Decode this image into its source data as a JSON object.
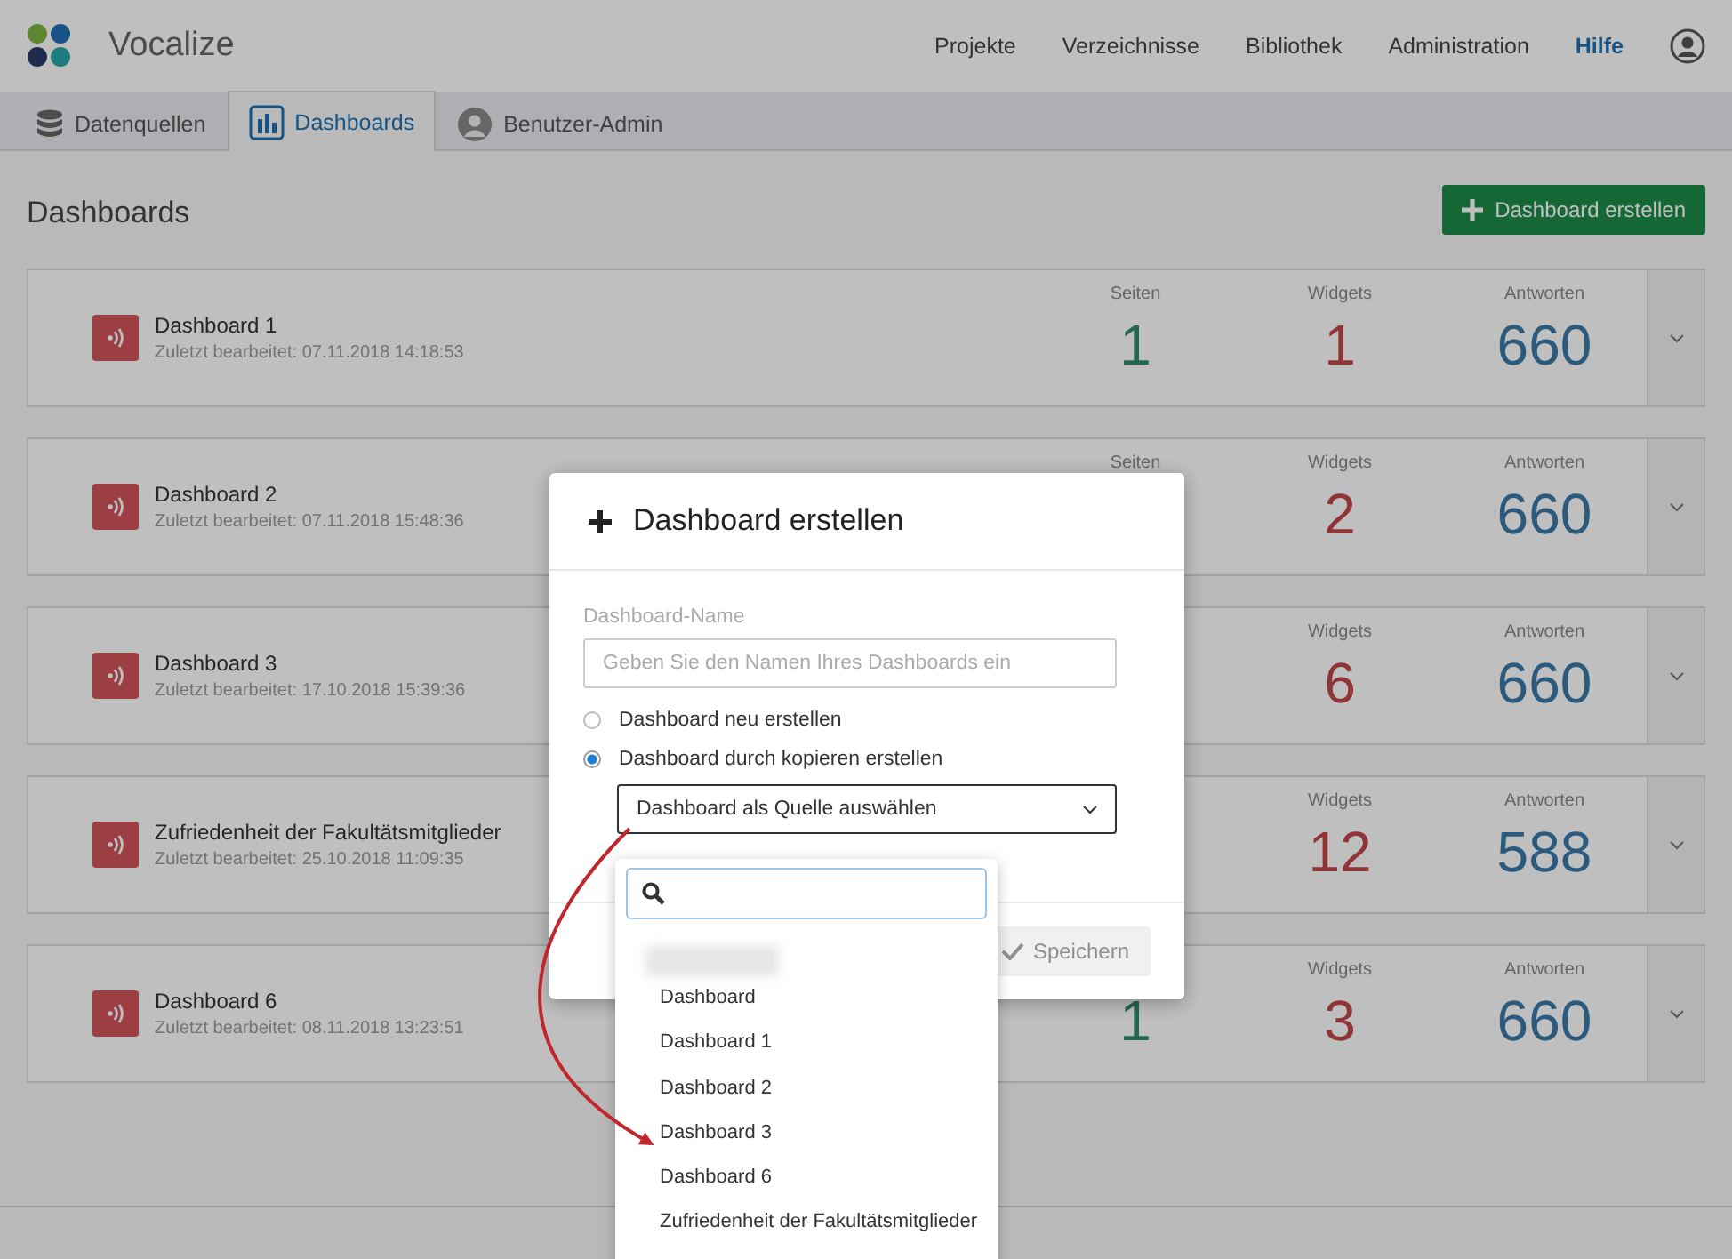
{
  "app": {
    "name": "Vocalize"
  },
  "nav": [
    {
      "label": "Projekte",
      "selected": false
    },
    {
      "label": "Verzeichnisse",
      "selected": false
    },
    {
      "label": "Bibliothek",
      "selected": false
    },
    {
      "label": "Administration",
      "selected": false
    },
    {
      "label": "Hilfe",
      "selected": true
    }
  ],
  "tabs": [
    {
      "label": "Datenquellen",
      "selected": false
    },
    {
      "label": "Dashboards",
      "selected": true
    },
    {
      "label": "Benutzer-Admin",
      "selected": false
    }
  ],
  "page_title": "Dashboards",
  "create_button": "Dashboard erstellen",
  "dashboards": [
    {
      "name": "Dashboard 1",
      "edited": "Zuletzt bearbeitet: 07.11.2018 14:18:53",
      "stats": [
        {
          "kind": "pages",
          "label": "Seiten",
          "value": "1"
        },
        {
          "kind": "widgets",
          "label": "Widgets",
          "value": "1"
        },
        {
          "kind": "responses",
          "label": "Antworten",
          "value": "660"
        }
      ]
    },
    {
      "name": "Dashboard 2",
      "edited": "Zuletzt bearbeitet: 07.11.2018 15:48:36",
      "stats": [
        {
          "kind": "pages",
          "label": "Seiten"
        },
        {
          "kind": "widgets",
          "label": "Widgets",
          "value": "2"
        },
        {
          "kind": "responses",
          "label": "Antworten",
          "value": "660"
        }
      ]
    },
    {
      "name": "Dashboard 3",
      "edited": "Zuletzt bearbeitet: 17.10.2018 15:39:36",
      "stats": [
        {
          "kind": "widgets",
          "label": "Widgets",
          "value": "6"
        },
        {
          "kind": "responses",
          "label": "Antworten",
          "value": "660"
        }
      ]
    },
    {
      "name": "Zufriedenheit der Fakultätsmitglieder",
      "edited": "Zuletzt bearbeitet: 25.10.2018 11:09:35",
      "stats": [
        {
          "kind": "widgets",
          "label": "Widgets",
          "value": "12"
        },
        {
          "kind": "responses",
          "label": "Antworten",
          "value": "588"
        }
      ]
    },
    {
      "name": "Dashboard 6",
      "edited": "Zuletzt bearbeitet: 08.11.2018 13:23:51",
      "stats": [
        {
          "kind": "pages",
          "value": "1"
        },
        {
          "kind": "widgets",
          "label": "Widgets",
          "value": "3"
        },
        {
          "kind": "responses",
          "label": "Antworten",
          "value": "660"
        }
      ]
    }
  ],
  "dialog": {
    "title": "Dashboard erstellen",
    "name_field": {
      "label": "Dashboard-Name",
      "placeholder": "Geben Sie den Namen Ihres Dashboards ein"
    },
    "options": [
      {
        "label": "Dashboard neu erstellen",
        "selected": false
      },
      {
        "label": "Dashboard durch kopieren erstellen",
        "selected": true
      }
    ],
    "source_select": "Dashboard als Quelle auswählen",
    "save_button": {
      "label": "Speichern",
      "disabled": true
    },
    "dropdown_items": [
      "Dashboard",
      "Dashboard 1",
      "Dashboard 2",
      "Dashboard 3",
      "Dashboard 6",
      "Zufriedenheit der Fakultätsmitglieder"
    ]
  }
}
